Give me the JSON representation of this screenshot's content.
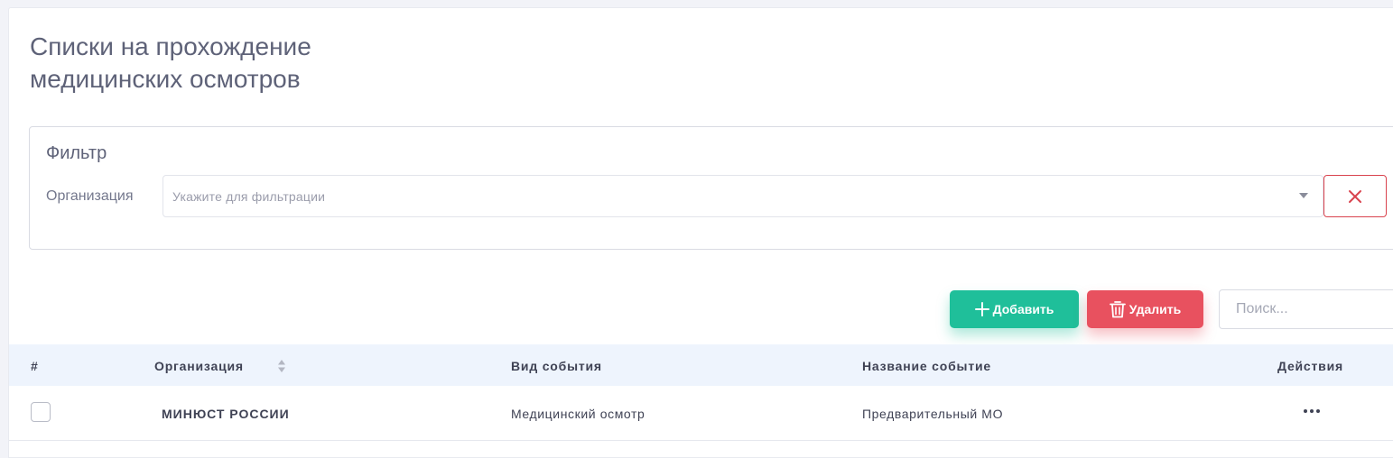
{
  "page": {
    "title": "Списки на прохождение\nмедицинских осмотров"
  },
  "filter": {
    "title": "Фильтр",
    "org_label": "Организация",
    "org_placeholder": "Укажите для фильтрации"
  },
  "toolbar": {
    "add_label": "Добавить",
    "delete_label": "Удалить",
    "search_placeholder": "Поиск..."
  },
  "table": {
    "columns": [
      "#",
      "Организация",
      "Вид события",
      "Название событие",
      "Действия"
    ],
    "rows": [
      {
        "organization": "МИНЮСТ РОССИИ",
        "event_type": "Медицинский осмотр",
        "event_name": "Предварительный МО"
      }
    ]
  },
  "colors": {
    "add": "#1fbf9a",
    "delete": "#e8515f",
    "header_bg": "#eef4fd"
  }
}
